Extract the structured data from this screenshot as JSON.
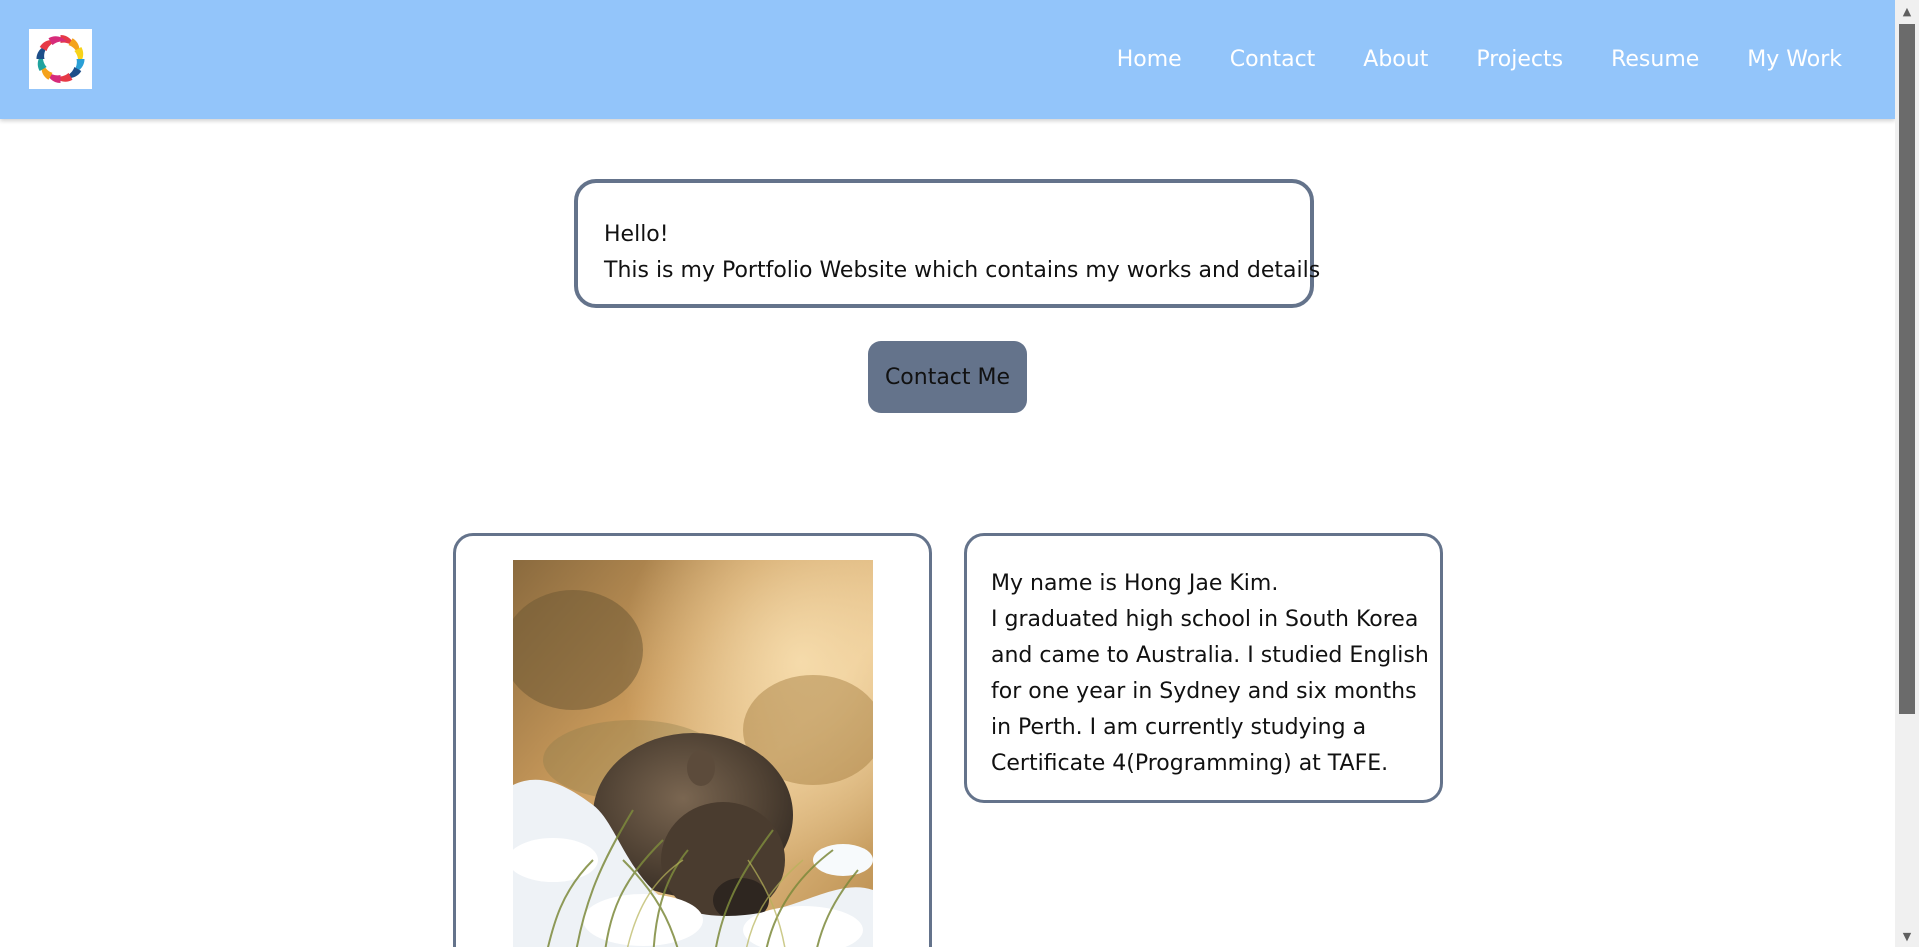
{
  "nav": {
    "items": [
      {
        "label": "Home"
      },
      {
        "label": "Contact"
      },
      {
        "label": "About"
      },
      {
        "label": "Projects"
      },
      {
        "label": "Resume"
      },
      {
        "label": "My Work"
      }
    ]
  },
  "hero": {
    "line1": "Hello!",
    "line2": "This is my Portfolio Website which contains my works and details"
  },
  "contact_button": {
    "label": "Contact Me"
  },
  "about": {
    "lines": [
      "My name is Hong Jae Kim.",
      "I graduated high school in South Korea",
      "and came to Australia. I studied English",
      "for one year in Sydney and six months",
      "in Perth. I am currently studying a",
      "Certificate 4(Programming) at TAFE."
    ]
  },
  "colors": {
    "header_bg": "#93c5fa",
    "accent": "#64738b",
    "nav_text": "#ffffff"
  },
  "icons": {
    "logo": "swirl-logo-icon",
    "photo": "wombat-photo",
    "scroll_up": "arrow-up-icon",
    "scroll_down": "arrow-down-icon"
  }
}
